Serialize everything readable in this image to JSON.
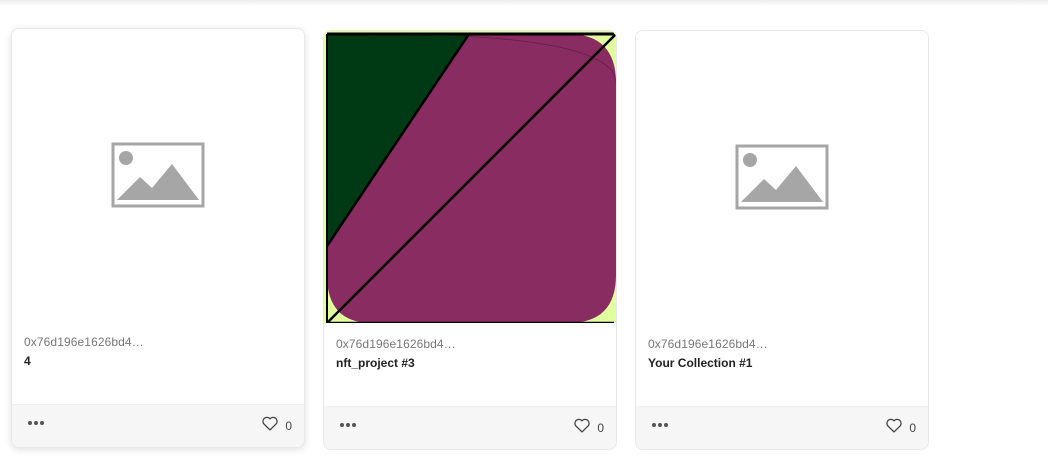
{
  "cards": [
    {
      "owner": "0x76d196e1626bd4…",
      "name": "4",
      "likes": "0",
      "media": "image-placeholder-icon"
    },
    {
      "owner": "0x76d196e1626bd4…",
      "name": "nft_project #3",
      "likes": "0",
      "media": "nft-artwork"
    },
    {
      "owner": "0x76d196e1626bd4…",
      "name": "Your Collection #1",
      "likes": "0",
      "media": "image-placeholder-icon"
    }
  ],
  "icons": {
    "more": "more-options-icon",
    "like": "heart-icon"
  },
  "colors": {
    "artwork_background": "#e2ff9e",
    "artwork_green": "#003a14",
    "artwork_purple": "#882c62",
    "placeholder_gray": "#a6a6a6"
  }
}
